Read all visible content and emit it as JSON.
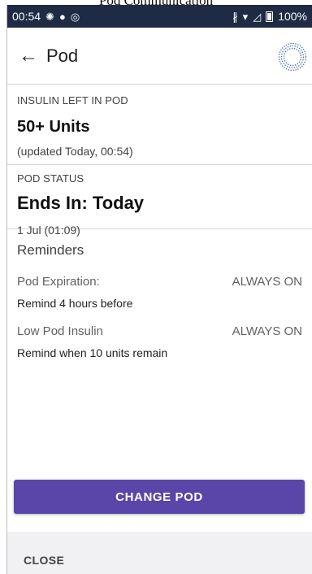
{
  "document": {
    "title": "Pod Communication"
  },
  "status_bar": {
    "time": "00:54",
    "battery": "100%",
    "left_icons": [
      "brightness-icon",
      "circle-icon",
      "sync-icon"
    ],
    "right_icons": [
      "bluetooth-icon",
      "wifi-icon",
      "signal-icon",
      "battery-icon"
    ]
  },
  "app_bar": {
    "title": "Pod"
  },
  "insulin": {
    "label": "INSULIN LEFT IN POD",
    "value": "50+ Units",
    "updated": "(updated Today, 00:54)"
  },
  "pod_status": {
    "label": "POD STATUS",
    "value": "Ends In: Today",
    "date": "1 Jul (01:09)"
  },
  "reminders": {
    "title": "Reminders",
    "items": [
      {
        "name": "Pod Expiration:",
        "state": "ALWAYS ON",
        "description": "Remind 4 hours before"
      },
      {
        "name": "Low Pod Insulin",
        "state": "ALWAYS ON",
        "description": "Remind when 10 units remain"
      }
    ]
  },
  "actions": {
    "change_pod": "CHANGE POD",
    "close": "CLOSE"
  },
  "colors": {
    "primary": "#5a46a8",
    "status_bar": "#1f2a44",
    "footer": "#f1f1f3"
  }
}
